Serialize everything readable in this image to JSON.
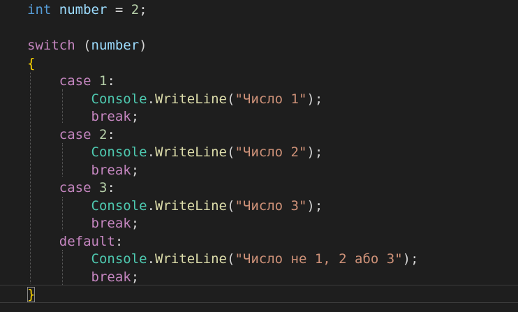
{
  "editor": {
    "language": "csharp",
    "lines": [
      [
        {
          "t": "int",
          "c": "type"
        },
        {
          "t": " ",
          "c": "op"
        },
        {
          "t": "number",
          "c": "var"
        },
        {
          "t": " = ",
          "c": "op"
        },
        {
          "t": "2",
          "c": "num"
        },
        {
          "t": ";",
          "c": "op"
        }
      ],
      [],
      [
        {
          "t": "switch",
          "c": "ctrl"
        },
        {
          "t": " (",
          "c": "op"
        },
        {
          "t": "number",
          "c": "var"
        },
        {
          "t": ")",
          "c": "op"
        }
      ],
      [
        {
          "t": "{",
          "c": "brace"
        }
      ],
      [
        {
          "t": "    ",
          "c": "op"
        },
        {
          "t": "case",
          "c": "ctrl"
        },
        {
          "t": " ",
          "c": "op"
        },
        {
          "t": "1",
          "c": "num"
        },
        {
          "t": ":",
          "c": "op"
        }
      ],
      [
        {
          "t": "        ",
          "c": "op"
        },
        {
          "t": "Console",
          "c": "cls"
        },
        {
          "t": ".",
          "c": "op"
        },
        {
          "t": "WriteLine",
          "c": "fn"
        },
        {
          "t": "(",
          "c": "op"
        },
        {
          "t": "\"Число 1\"",
          "c": "str"
        },
        {
          "t": ");",
          "c": "op"
        }
      ],
      [
        {
          "t": "        ",
          "c": "op"
        },
        {
          "t": "break",
          "c": "ctrl"
        },
        {
          "t": ";",
          "c": "op"
        }
      ],
      [
        {
          "t": "    ",
          "c": "op"
        },
        {
          "t": "case",
          "c": "ctrl"
        },
        {
          "t": " ",
          "c": "op"
        },
        {
          "t": "2",
          "c": "num"
        },
        {
          "t": ":",
          "c": "op"
        }
      ],
      [
        {
          "t": "        ",
          "c": "op"
        },
        {
          "t": "Console",
          "c": "cls"
        },
        {
          "t": ".",
          "c": "op"
        },
        {
          "t": "WriteLine",
          "c": "fn"
        },
        {
          "t": "(",
          "c": "op"
        },
        {
          "t": "\"Число 2\"",
          "c": "str"
        },
        {
          "t": ");",
          "c": "op"
        }
      ],
      [
        {
          "t": "        ",
          "c": "op"
        },
        {
          "t": "break",
          "c": "ctrl"
        },
        {
          "t": ";",
          "c": "op"
        }
      ],
      [
        {
          "t": "    ",
          "c": "op"
        },
        {
          "t": "case",
          "c": "ctrl"
        },
        {
          "t": " ",
          "c": "op"
        },
        {
          "t": "3",
          "c": "num"
        },
        {
          "t": ":",
          "c": "op"
        }
      ],
      [
        {
          "t": "        ",
          "c": "op"
        },
        {
          "t": "Console",
          "c": "cls"
        },
        {
          "t": ".",
          "c": "op"
        },
        {
          "t": "WriteLine",
          "c": "fn"
        },
        {
          "t": "(",
          "c": "op"
        },
        {
          "t": "\"Число 3\"",
          "c": "str"
        },
        {
          "t": ");",
          "c": "op"
        }
      ],
      [
        {
          "t": "        ",
          "c": "op"
        },
        {
          "t": "break",
          "c": "ctrl"
        },
        {
          "t": ";",
          "c": "op"
        }
      ],
      [
        {
          "t": "    ",
          "c": "op"
        },
        {
          "t": "default",
          "c": "ctrl"
        },
        {
          "t": ":",
          "c": "op"
        }
      ],
      [
        {
          "t": "        ",
          "c": "op"
        },
        {
          "t": "Console",
          "c": "cls"
        },
        {
          "t": ".",
          "c": "op"
        },
        {
          "t": "WriteLine",
          "c": "fn"
        },
        {
          "t": "(",
          "c": "op"
        },
        {
          "t": "\"Число не 1, 2 або 3\"",
          "c": "str"
        },
        {
          "t": ");",
          "c": "op"
        }
      ],
      [
        {
          "t": "        ",
          "c": "op"
        },
        {
          "t": "break",
          "c": "ctrl"
        },
        {
          "t": ";",
          "c": "op"
        }
      ],
      [
        {
          "t": "}",
          "c": "brace"
        }
      ]
    ]
  },
  "colors": {
    "background": "#1e1e1e",
    "type_keyword": "#569cd6",
    "variable": "#9cdcfe",
    "number": "#b5cea8",
    "control_keyword": "#c586c0",
    "class_name": "#4ec9b0",
    "method": "#dcdcaa",
    "string": "#ce9178",
    "bracket": "#ffd700",
    "punctuation": "#d4d4d4"
  }
}
